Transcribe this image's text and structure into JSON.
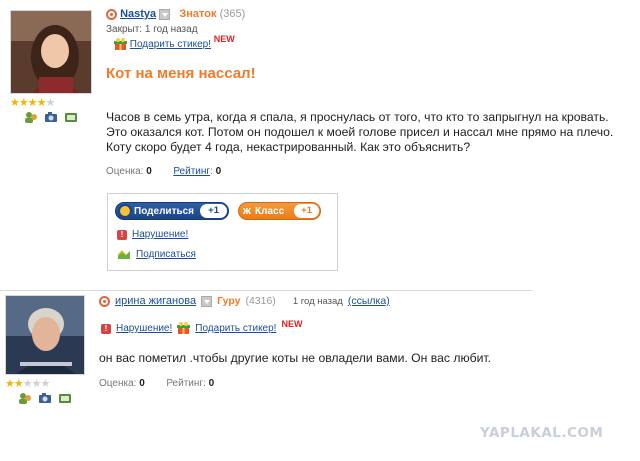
{
  "question": {
    "author": "Nastya",
    "rank": "Знаток",
    "rank_points": "(365)",
    "closed": "Закрыт: 1 год назад",
    "gift_link": "Подарить стикер!",
    "new_badge": "NEW",
    "rating_stars": 4,
    "rating_stars_max": 5,
    "title": "Кот на меня нассал!",
    "text": "Часов в семь утра, когда я спала, я проснулась от того, что кто то запрыгнул на кровать. Это оказался кот. Потом он подошел к моей голове присел и нассал мне прямо на плечо. Коту скоро будет 4 года, некастрированный. Как это объяснить?",
    "score_label": "Оценка:",
    "score_value": "0",
    "rating_label": "Рейтинг",
    "rating_value": "0"
  },
  "share_box": {
    "share_label": "Поделиться",
    "share_count": "+1",
    "class_label": "Класс",
    "class_count": "+1",
    "violation_label": "Нарушение!",
    "subscribe_label": "Подписаться"
  },
  "answer": {
    "author": "ирина жиганова",
    "rank": "Гуру",
    "rank_points": "(4316)",
    "time": "1 год назад",
    "link_label": "(ссылка)",
    "violation_label": "Нарушение!",
    "gift_link": "Подарить стикер!",
    "new_badge": "NEW",
    "rating_stars": 2,
    "rating_stars_max": 5,
    "text": "он вас пометил .чтобы другие коты не овладели вами. Он вас любит.",
    "score_label": "Оценка:",
    "score_value": "0",
    "rating_label": "Рейтинг:",
    "rating_value": "0"
  },
  "watermark": "YAPLAKAL.COM",
  "colors": {
    "accent_orange": "#f07b28",
    "link_blue": "#1a4f96",
    "star_gold": "#f2b500",
    "new_red": "#e02020"
  }
}
